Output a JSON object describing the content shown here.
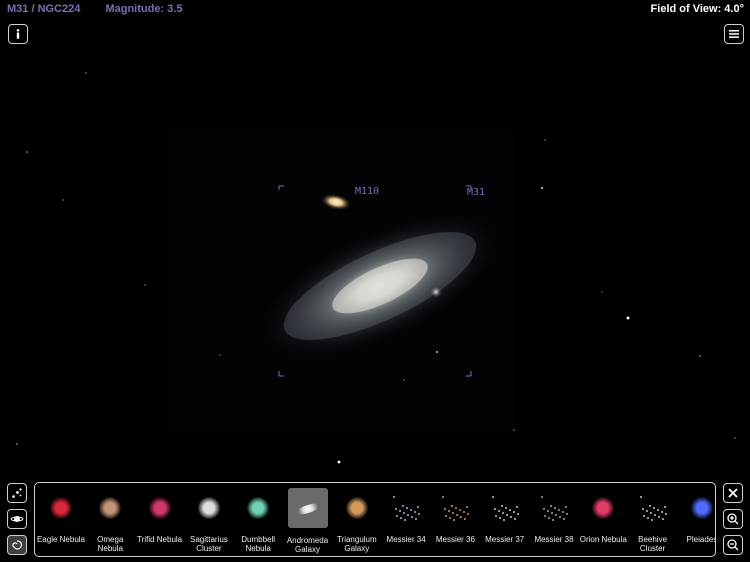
{
  "header": {
    "object_id": "M31 / NGC224",
    "magnitude": "Magnitude: 3.5",
    "field_of_view": "Field of View: 4.0°"
  },
  "sky_labels": {
    "m110": "M110",
    "m31": "M31"
  },
  "toolbar": {
    "info_icon": "info-icon",
    "menu_icon": "list-menu-icon",
    "left_buttons": [
      "star-cluster-icon",
      "planet-icon",
      "galaxy-icon"
    ],
    "right_buttons": [
      "close-icon",
      "zoom-in-icon",
      "zoom-out-icon"
    ]
  },
  "tray": {
    "items": [
      {
        "label": "Eagle Nebula",
        "color": "#d8283c"
      },
      {
        "label": "Omega Nebula",
        "color": "#c59377"
      },
      {
        "label": "Trifid Nebula",
        "color": "#d2386a"
      },
      {
        "label": "Sagittarius Cluster",
        "color": "#dddddd"
      },
      {
        "label": "Dumbbell Nebula",
        "color": "#6fd3b7"
      },
      {
        "label": "Andromeda Galaxy",
        "color": "#ffffff",
        "selected": true
      },
      {
        "label": "Triangulum Galaxy",
        "color": "#d59a5b"
      },
      {
        "label": "Messier 34",
        "color": "#b9c5ff"
      },
      {
        "label": "Messier 36",
        "color": "#d6a38a"
      },
      {
        "label": "Messier 37",
        "color": "#dcdcdc"
      },
      {
        "label": "Messier 38",
        "color": "#b7b7b7"
      },
      {
        "label": "Orion Nebula",
        "color": "#e43a68"
      },
      {
        "label": "Beehive Cluster",
        "color": "#dfdfdf"
      },
      {
        "label": "Pleiades",
        "color": "#4e6bff"
      }
    ]
  },
  "colors": {
    "accent": "#7d6fb3",
    "border": "#cfcfcf",
    "background": "#000000"
  }
}
